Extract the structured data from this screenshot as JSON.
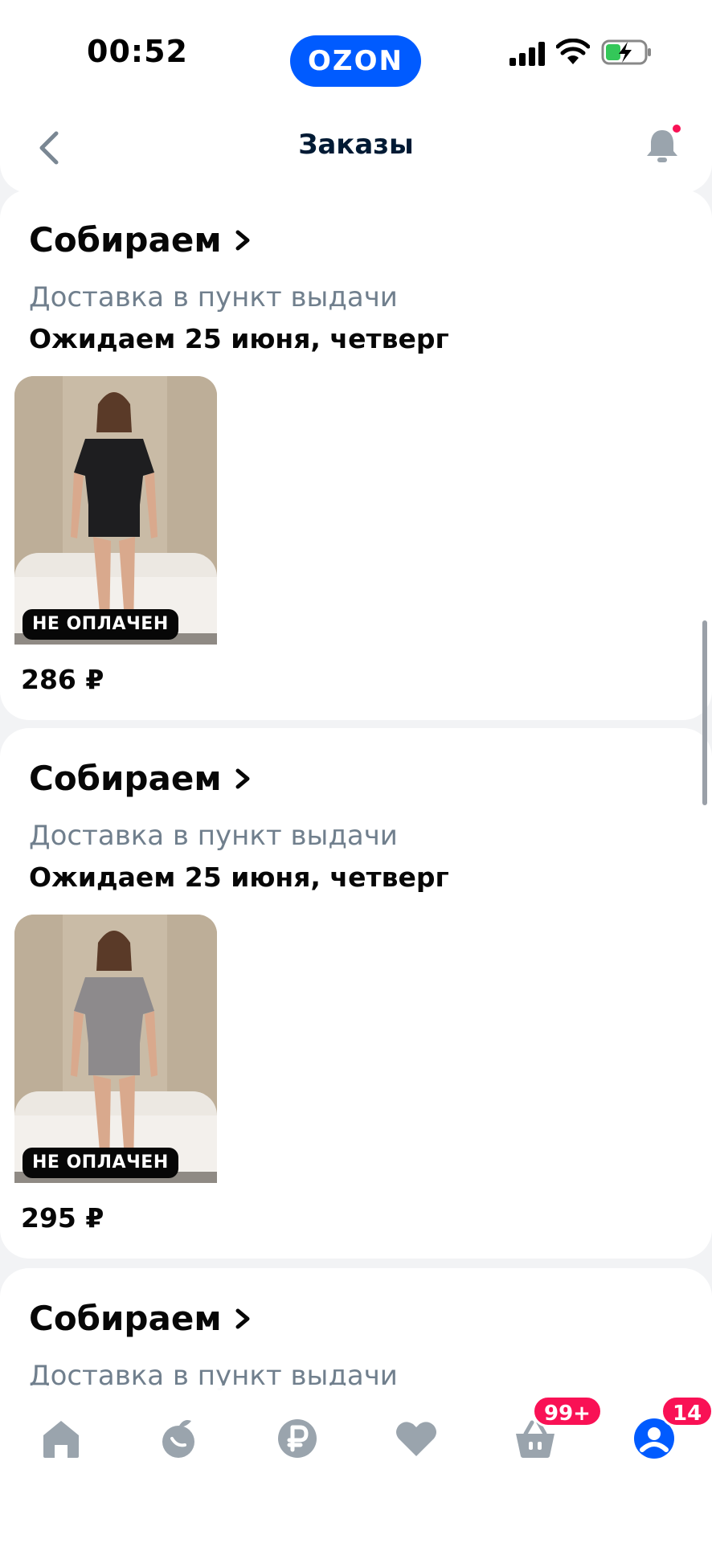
{
  "status_bar": {
    "time": "00:52",
    "brand": "OZON"
  },
  "header": {
    "title": "Заказы"
  },
  "orders": [
    {
      "status": "Собираем",
      "delivery": "Доставка в пункт выдачи",
      "eta": "Ожидаем 25 июня, четверг",
      "badge": "НЕ ОПЛАЧЕН",
      "price": "286 ₽",
      "shirt_color": "#1e1e20"
    },
    {
      "status": "Собираем",
      "delivery": "Доставка в пункт выдачи",
      "eta": "Ожидаем 25 июня, четверг",
      "badge": "НЕ ОПЛАЧЕН",
      "price": "295 ₽",
      "shirt_color": "#8d8a8c"
    },
    {
      "status": "Собираем",
      "delivery": "Доставка в пункт выдачи"
    }
  ],
  "tab_bar": {
    "items": [
      {
        "icon": "home-icon"
      },
      {
        "icon": "fresh-icon"
      },
      {
        "icon": "ruble-icon"
      },
      {
        "icon": "heart-icon"
      },
      {
        "icon": "cart-icon",
        "badge": "99+"
      },
      {
        "icon": "profile-icon",
        "badge": "14"
      }
    ]
  },
  "colors": {
    "accent": "#005bff",
    "badge": "#f91155",
    "muted": "#707f8d"
  }
}
